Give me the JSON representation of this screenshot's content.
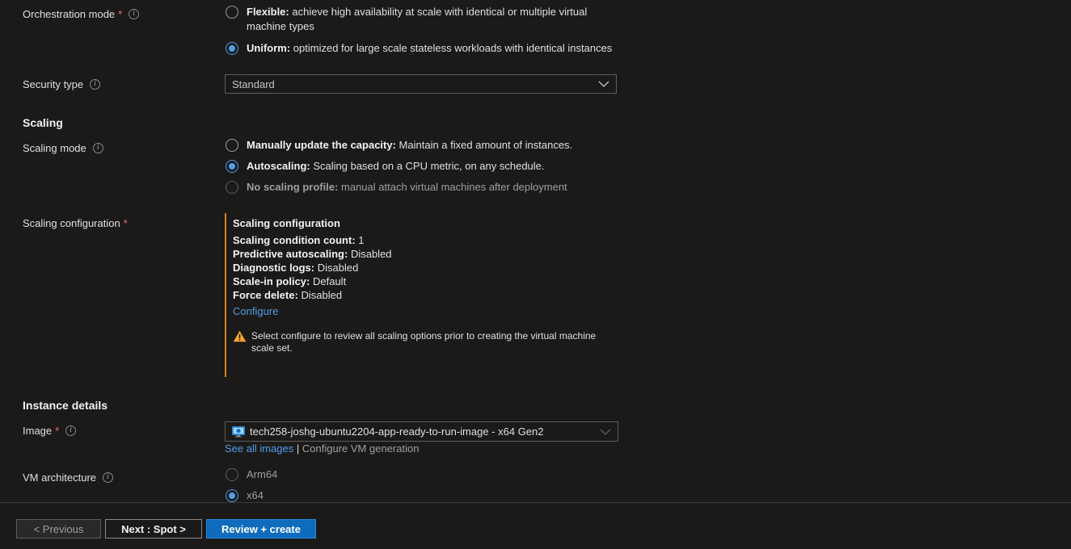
{
  "orchestration": {
    "label": "Orchestration mode",
    "required": "*",
    "options": [
      {
        "bold": "Flexible:",
        "text": " achieve high availability at scale with identical or multiple virtual machine types"
      },
      {
        "bold": "Uniform:",
        "text": " optimized for large scale stateless workloads with identical instances"
      }
    ]
  },
  "security": {
    "label": "Security type",
    "value": "Standard"
  },
  "scaling_section": "Scaling",
  "scaling_mode": {
    "label": "Scaling mode",
    "options": [
      {
        "bold": "Manually update the capacity:",
        "text": " Maintain a fixed amount of instances."
      },
      {
        "bold": "Autoscaling:",
        "text": " Scaling based on a CPU metric, on any schedule."
      },
      {
        "bold": "No scaling profile:",
        "text": " manual attach virtual machines after deployment"
      }
    ]
  },
  "scaling_config": {
    "label": "Scaling configuration",
    "required": "*",
    "title": "Scaling configuration",
    "rows": [
      {
        "key": "Scaling condition count:",
        "value": " 1"
      },
      {
        "key": "Predictive autoscaling:",
        "value": " Disabled"
      },
      {
        "key": "Diagnostic logs:",
        "value": " Disabled"
      },
      {
        "key": "Scale-in policy:",
        "value": " Default"
      },
      {
        "key": "Force delete:",
        "value": " Disabled"
      }
    ],
    "configure_link": "Configure",
    "warning": "Select configure to review all scaling options prior to creating the virtual machine scale set."
  },
  "instance_section": "Instance details",
  "image": {
    "label": "Image",
    "required": "*",
    "value": "tech258-joshg-ubuntu2204-app-ready-to-run-image - x64 Gen2",
    "see_all": "See all images",
    "separator": " | ",
    "configure_gen": "Configure VM generation"
  },
  "vm_arch": {
    "label": "VM architecture",
    "options": [
      "Arm64",
      "x64"
    ]
  },
  "footer": {
    "previous": "< Previous",
    "next": "Next : Spot >",
    "review": "Review + create"
  },
  "colors": {
    "accent": "#4f9fe6",
    "warning": "#d97e1e",
    "primary_button": "#0f6cbd",
    "required": "#f1707b"
  }
}
